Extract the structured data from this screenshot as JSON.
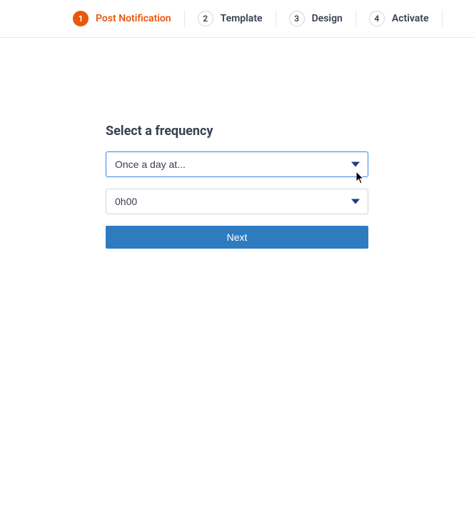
{
  "stepper": {
    "steps": [
      {
        "number": "1",
        "label": "Post Notification"
      },
      {
        "number": "2",
        "label": "Template"
      },
      {
        "number": "3",
        "label": "Design"
      },
      {
        "number": "4",
        "label": "Activate"
      }
    ]
  },
  "main": {
    "heading": "Select a frequency",
    "frequency_value": "Once a day at...",
    "time_value": "0h00",
    "next_label": "Next"
  },
  "colors": {
    "accent": "#ea580c",
    "primary_btn": "#2f7bbf",
    "focus_border": "#3b82f6",
    "caret": "#1e3a8a"
  }
}
